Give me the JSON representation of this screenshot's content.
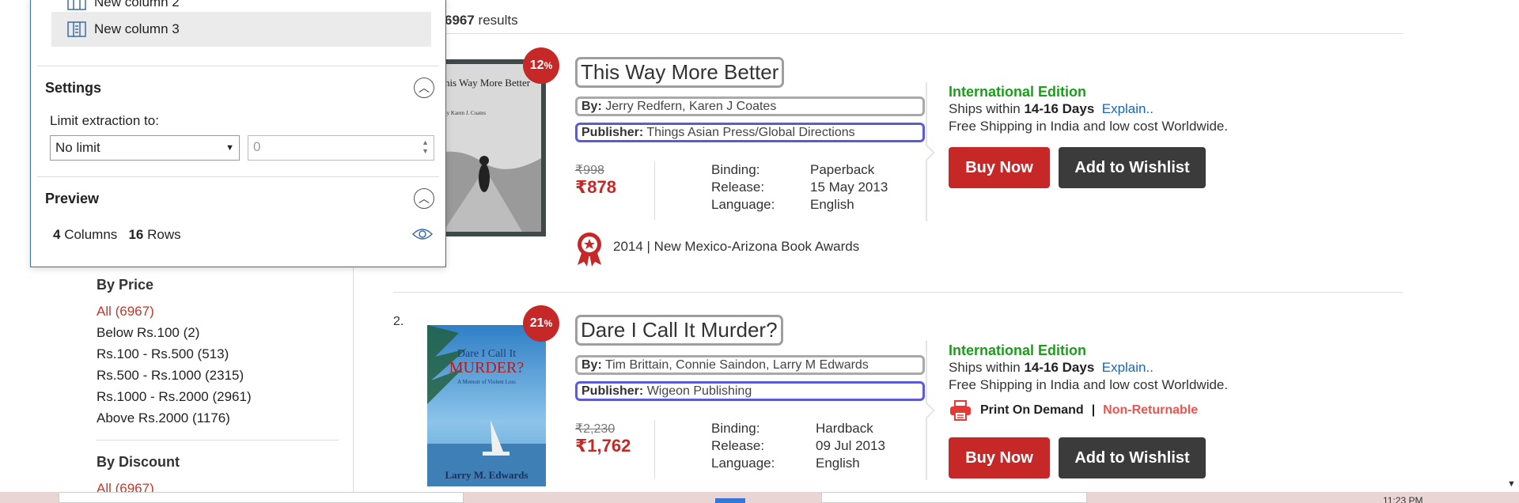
{
  "results": {
    "count": "6967",
    "suffix": " results"
  },
  "filters": {
    "price": {
      "title": "By Price",
      "items": [
        "All (6967)",
        "Below Rs.100 (2)",
        "Rs.100 - Rs.500 (513)",
        "Rs.500 - Rs.1000 (2315)",
        "Rs.1000 - Rs.2000 (2961)",
        "Above Rs.2000 (1176)"
      ]
    },
    "discount": {
      "title": "By Discount",
      "items": [
        "All (6967)"
      ]
    }
  },
  "panel": {
    "column_partial": "New column 2",
    "column_selected": "New column 3",
    "settings_title": "Settings",
    "limit_label": "Limit extraction to:",
    "limit_value": "No limit",
    "limit_number": "0",
    "preview_title": "Preview",
    "columns_count": "4",
    "columns_label": "Columns",
    "rows_count": "16",
    "rows_label": "Rows"
  },
  "books": [
    {
      "index": "",
      "discount": "12",
      "title": "This Way More Better",
      "by_label": "By:",
      "authors": "Jerry Redfern, Karen J Coates",
      "publisher_label": "Publisher:",
      "publisher": "Things Asian Press/Global Directions",
      "mrp": "₹998",
      "price": "₹878",
      "binding_label": "Binding:",
      "binding": "Paperback",
      "release_label": "Release:",
      "release": "15 May 2013",
      "language_label": "Language:",
      "language": "English",
      "award": "2014 | New Mexico-Arizona Book Awards",
      "edition": "International Edition",
      "ships_prefix": "Ships within ",
      "ships_days": "14-16 Days",
      "explain": "Explain..",
      "free_shipping": "Free Shipping in India and low cost Worldwide.",
      "buy_label": "Buy Now",
      "wishlist_label": "Add to Wishlist",
      "cover_title": "This Way More Better",
      "cover_author": "By Karen J. Coates"
    },
    {
      "index": "2.",
      "discount": "21",
      "title": "Dare I Call It Murder?",
      "by_label": "By:",
      "authors": "Tim Brittain, Connie Saindon, Larry M Edwards",
      "publisher_label": "Publisher:",
      "publisher": "Wigeon Publishing",
      "mrp": "₹2,230",
      "price": "₹1,762",
      "binding_label": "Binding:",
      "binding": "Hardback",
      "release_label": "Release:",
      "release": "09 Jul 2013",
      "language_label": "Language:",
      "language": "English",
      "edition": "International Edition",
      "ships_prefix": "Ships within ",
      "ships_days": "14-16 Days",
      "explain": "Explain..",
      "free_shipping": "Free Shipping in India and low cost Worldwide.",
      "pod_label": "Print On Demand",
      "pod_sep": "|",
      "nonreturnable": "Non-Returnable",
      "buy_label": "Buy Now",
      "wishlist_label": "Add to Wishlist",
      "cover_title_1": "Dare I Call It",
      "cover_title_2": "MURDER?",
      "cover_sub": "A Memoir of Violent Loss",
      "cover_author": "Larry M. Edwards"
    }
  ],
  "taskbar": {
    "clock": "11:23 PM"
  },
  "percent_sign": "%",
  "colors": {
    "accent_red": "#c62828",
    "green": "#1a9e1a",
    "link_blue": "#1565c0",
    "panel_border": "#3a6ea5"
  }
}
